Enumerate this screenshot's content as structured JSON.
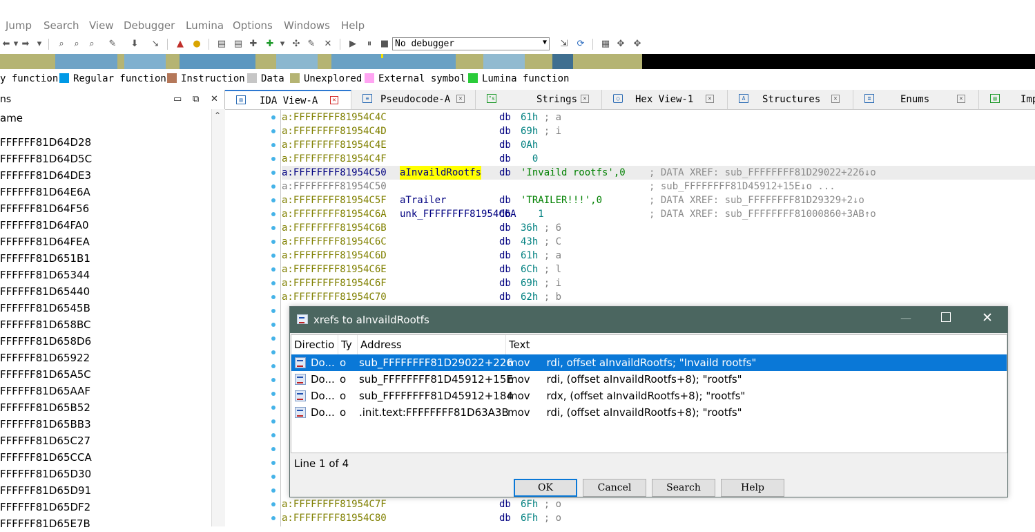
{
  "menu": [
    "Jump",
    "Search",
    "View",
    "Debugger",
    "Lumina",
    "Options",
    "Windows",
    "Help"
  ],
  "toolbar": {
    "debugger_value": "No debugger"
  },
  "legend": [
    {
      "label": "y function",
      "color": ""
    },
    {
      "label": "Regular function",
      "color": "#0099e6"
    },
    {
      "label": "Instruction",
      "color": "#b5785a"
    },
    {
      "label": "Data",
      "color": "#c6c6c6"
    },
    {
      "label": "Unexplored",
      "color": "#b5b473"
    },
    {
      "label": "External symbol",
      "color": "#ffa4f2"
    },
    {
      "label": "Lumina function",
      "color": "#2acc3a"
    }
  ],
  "functions_panel": {
    "title": "ns",
    "column_header": "ame",
    "items": [
      "FFFFFF81D64D28",
      "FFFFFF81D64D5C",
      "FFFFFF81D64DE3",
      "FFFFFF81D64E6A",
      "FFFFFF81D64F56",
      "FFFFFF81D64FA0",
      "FFFFFF81D64FEA",
      "FFFFFF81D651B1",
      "FFFFFF81D65344",
      "FFFFFF81D65440",
      "FFFFFF81D6545B",
      "FFFFFF81D658BC",
      "FFFFFF81D658D6",
      "FFFFFF81D65922",
      "FFFFFF81D65A5C",
      "FFFFFF81D65AAF",
      "FFFFFF81D65B52",
      "FFFFFF81D65BB3",
      "FFFFFF81D65C27",
      "FFFFFF81D65CCA",
      "FFFFFF81D65D30",
      "FFFFFF81D65D91",
      "FFFFFF81D65DF2",
      "FFFFFF81D65E7B"
    ]
  },
  "tabs": [
    {
      "label": "IDA View-A",
      "active": true
    },
    {
      "label": "Pseudocode-A",
      "active": false
    },
    {
      "label": "Strings",
      "active": false
    },
    {
      "label": "Hex View-1",
      "active": false
    },
    {
      "label": "Structures",
      "active": false
    },
    {
      "label": "Enums",
      "active": false
    },
    {
      "label": "Imp",
      "active": false
    }
  ],
  "ida_rows": [
    {
      "addr": "a:FFFFFFFF81954C4C",
      "label": "",
      "ins": "db",
      "op": "61h",
      "cm": "; a",
      "xref": ""
    },
    {
      "addr": "a:FFFFFFFF81954C4D",
      "label": "",
      "ins": "db",
      "op": "69h",
      "cm": "; i",
      "xref": ""
    },
    {
      "addr": "a:FFFFFFFF81954C4E",
      "label": "",
      "ins": "db",
      "op": "0Ah",
      "cm": "",
      "xref": ""
    },
    {
      "addr": "a:FFFFFFFF81954C4F",
      "label": "",
      "ins": "db",
      "op": "  0",
      "cm": "",
      "xref": ""
    },
    {
      "addr": "a:FFFFFFFF81954C50",
      "label": "aInvaildRootfs",
      "ins": "db",
      "op": "'Invaild rootfs',0",
      "cm": "",
      "xref": "; DATA XREF: sub_FFFFFFFF81D29022+226↓o"
    },
    {
      "addr": "a:FFFFFFFF81954C50",
      "label": "",
      "ins": "",
      "op": "",
      "cm": "",
      "xref": "; sub_FFFFFFFF81D45912+15E↓o ..."
    },
    {
      "addr": "a:FFFFFFFF81954C5F",
      "label": "aTrailer",
      "ins": "db",
      "op": "'TRAILER!!!',0",
      "cm": "",
      "xref": "; DATA XREF: sub_FFFFFFFF81D29329+2↓o"
    },
    {
      "addr": "a:FFFFFFFF81954C6A",
      "label": "unk_FFFFFFFF81954C6A",
      "ins": "db",
      "op": "   1",
      "cm": "",
      "xref": "; DATA XREF: sub_FFFFFFFF81000860+3AB↑o"
    },
    {
      "addr": "a:FFFFFFFF81954C6B",
      "label": "",
      "ins": "db",
      "op": "36h",
      "cm": "; 6",
      "xref": ""
    },
    {
      "addr": "a:FFFFFFFF81954C6C",
      "label": "",
      "ins": "db",
      "op": "43h",
      "cm": "; C",
      "xref": ""
    },
    {
      "addr": "a:FFFFFFFF81954C6D",
      "label": "",
      "ins": "db",
      "op": "61h",
      "cm": "; a",
      "xref": ""
    },
    {
      "addr": "a:FFFFFFFF81954C6E",
      "label": "",
      "ins": "db",
      "op": "6Ch",
      "cm": "; l",
      "xref": ""
    },
    {
      "addr": "a:FFFFFFFF81954C6F",
      "label": "",
      "ins": "db",
      "op": "69h",
      "cm": "; i",
      "xref": ""
    },
    {
      "addr": "a:FFFFFFFF81954C70",
      "label": "",
      "ins": "db",
      "op": "62h",
      "cm": "; b",
      "xref": ""
    }
  ],
  "ida_rows_bottom": [
    {
      "addr": "a:FFFFFFFF81954C7F",
      "ins": "db",
      "op": "6Fh",
      "cm": "; o"
    },
    {
      "addr": "a:FFFFFFFF81954C80",
      "ins": "db",
      "op": "6Fh",
      "cm": "; o"
    }
  ],
  "dialog": {
    "title": "xrefs to aInvaildRootfs",
    "columns": [
      "Directio",
      "Ty",
      "Address",
      "Text"
    ],
    "rows": [
      {
        "dir": "Do...",
        "type": "o",
        "address": "sub_FFFFFFFF81D29022+226",
        "text": "mov     rdi, offset aInvaildRootfs; \"Invaild rootfs\"",
        "selected": true
      },
      {
        "dir": "Do...",
        "type": "o",
        "address": "sub_FFFFFFFF81D45912+15E",
        "text": "mov     rdi, (offset aInvaildRootfs+8); \"rootfs\"",
        "selected": false
      },
      {
        "dir": "Do...",
        "type": "o",
        "address": "sub_FFFFFFFF81D45912+184",
        "text": "mov     rdx, (offset aInvaildRootfs+8); \"rootfs\"",
        "selected": false
      },
      {
        "dir": "Do...",
        "type": "o",
        "address": ".init.text:FFFFFFFF81D63A3B",
        "text": "mov     rdi, (offset aInvaildRootfs+8); \"rootfs\"",
        "selected": false
      }
    ],
    "status": "Line 1 of 4",
    "buttons": {
      "ok": "OK",
      "cancel": "Cancel",
      "search": "Search",
      "help": "Help"
    }
  }
}
